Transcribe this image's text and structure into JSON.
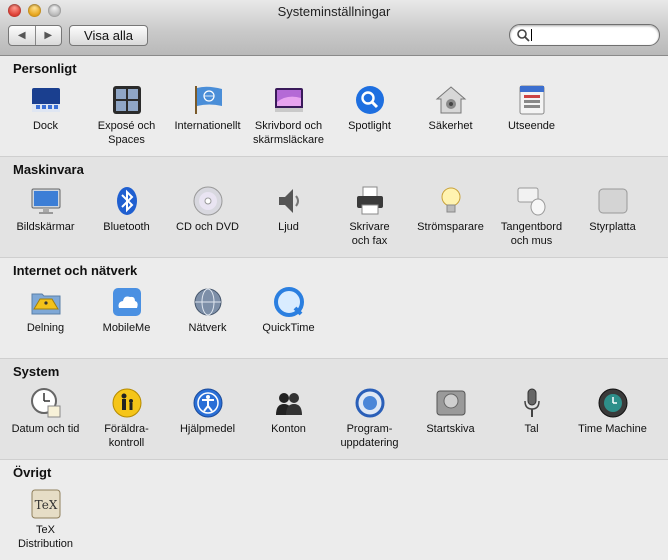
{
  "window": {
    "title": "Systeminställningar",
    "nav_back": "◀",
    "nav_forward": "▶",
    "show_all": "Visa alla",
    "search": {
      "value": "",
      "placeholder": ""
    }
  },
  "sections": [
    {
      "title": "Personligt",
      "items": [
        {
          "label": "Dock",
          "icon": "dock-icon"
        },
        {
          "label": "Exposé och\nSpaces",
          "icon": "expose-icon"
        },
        {
          "label": "Internationellt",
          "icon": "un-flag-icon"
        },
        {
          "label": "Skrivbord och\nskärmsläckare",
          "icon": "desktop-icon"
        },
        {
          "label": "Spotlight",
          "icon": "spotlight-icon"
        },
        {
          "label": "Säkerhet",
          "icon": "house-lock-icon"
        },
        {
          "label": "Utseende",
          "icon": "appearance-icon"
        }
      ]
    },
    {
      "title": "Maskinvara",
      "items": [
        {
          "label": "Bildskärmar",
          "icon": "monitor-icon"
        },
        {
          "label": "Bluetooth",
          "icon": "bluetooth-icon"
        },
        {
          "label": "CD och DVD",
          "icon": "disc-icon"
        },
        {
          "label": "Ljud",
          "icon": "speaker-icon"
        },
        {
          "label": "Skrivare\noch fax",
          "icon": "printer-icon"
        },
        {
          "label": "Strömsparare",
          "icon": "lightbulb-icon"
        },
        {
          "label": "Tangentbord\noch mus",
          "icon": "keyboard-mouse-icon"
        },
        {
          "label": "Styrplatta",
          "icon": "trackpad-icon"
        }
      ]
    },
    {
      "title": "Internet och nätverk",
      "items": [
        {
          "label": "Delning",
          "icon": "sharing-folder-icon"
        },
        {
          "label": "MobileMe",
          "icon": "cloud-icon"
        },
        {
          "label": "Nätverk",
          "icon": "globe-icon"
        },
        {
          "label": "QuickTime",
          "icon": "quicktime-icon"
        }
      ]
    },
    {
      "title": "System",
      "items": [
        {
          "label": "Datum och tid",
          "icon": "clock-icon"
        },
        {
          "label": "Föräldra-\nkontroll",
          "icon": "parental-icon"
        },
        {
          "label": "Hjälpmedel",
          "icon": "accessibility-icon"
        },
        {
          "label": "Konton",
          "icon": "accounts-icon"
        },
        {
          "label": "Program-\nuppdatering",
          "icon": "software-update-icon"
        },
        {
          "label": "Startskiva",
          "icon": "startup-disk-icon"
        },
        {
          "label": "Tal",
          "icon": "microphone-icon"
        },
        {
          "label": "Time Machine",
          "icon": "time-machine-icon"
        }
      ]
    },
    {
      "title": "Övrigt",
      "items": [
        {
          "label": "TeX\nDistribution",
          "icon": "tex-icon"
        }
      ]
    }
  ]
}
